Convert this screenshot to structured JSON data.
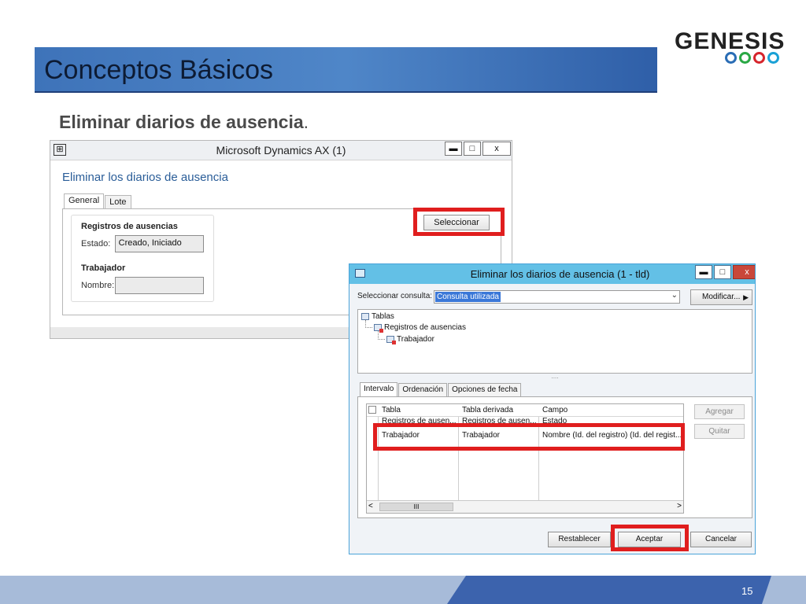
{
  "slide": {
    "title": "Conceptos Básicos",
    "subtitle": "Eliminar diarios de ausencia",
    "subtitle_period": ".",
    "page_number": "15",
    "logo": {
      "text": "GENESIS",
      "dot_colors": [
        "#2a6db5",
        "#2aa845",
        "#d6252c",
        "#1aa1d6"
      ]
    },
    "colors": {
      "title_bar": "#3e73b9",
      "highlight_box": "#e01e1e",
      "footer_dark": "#3c63ad",
      "footer_light": "#a7bbd9"
    }
  },
  "window1": {
    "icon_glyph": "⊞",
    "title": "Microsoft Dynamics AX (1)",
    "controls": {
      "minimize": "▬",
      "maximize": "□",
      "close": "x"
    },
    "heading": "Eliminar los diarios de ausencia",
    "tabs": [
      "General",
      "Lote"
    ],
    "select_button": "Seleccionar",
    "group_registros": {
      "header": "Registros de ausencias",
      "estado_label": "Estado:",
      "estado_value": "Creado, Iniciado"
    },
    "group_trabajador": {
      "header": "Trabajador",
      "nombre_label": "Nombre:",
      "nombre_value": ""
    }
  },
  "window2": {
    "title": "Eliminar los diarios de ausencia (1 - tld)",
    "controls": {
      "minimize": "▬",
      "maximize": "□",
      "close": "x"
    },
    "query_label": "Seleccionar consulta:",
    "query_value": "Consulta utilizada",
    "modify_button": "Modificar...",
    "tree": {
      "root": "Tablas",
      "child": "Registros de ausencias",
      "grandchild": "Trabajador"
    },
    "splitter": "....",
    "tabs": [
      "Intervalo",
      "Ordenación",
      "Opciones de fecha"
    ],
    "grid": {
      "columns": [
        "Tabla",
        "Tabla derivada",
        "Campo"
      ],
      "rows": [
        [
          "Registros de ausen...",
          "Registros de ausen...",
          "Estado"
        ],
        [
          "Trabajador",
          "Trabajador",
          "Nombre (Id. del registro) (Id. del regist..."
        ]
      ],
      "scroll_left": "<",
      "scroll_right": ">",
      "scroll_thumb": "III"
    },
    "add_button": "Agregar",
    "remove_button": "Quitar",
    "reset_button": "Restablecer",
    "accept_button": "Aceptar",
    "cancel_button": "Cancelar"
  }
}
